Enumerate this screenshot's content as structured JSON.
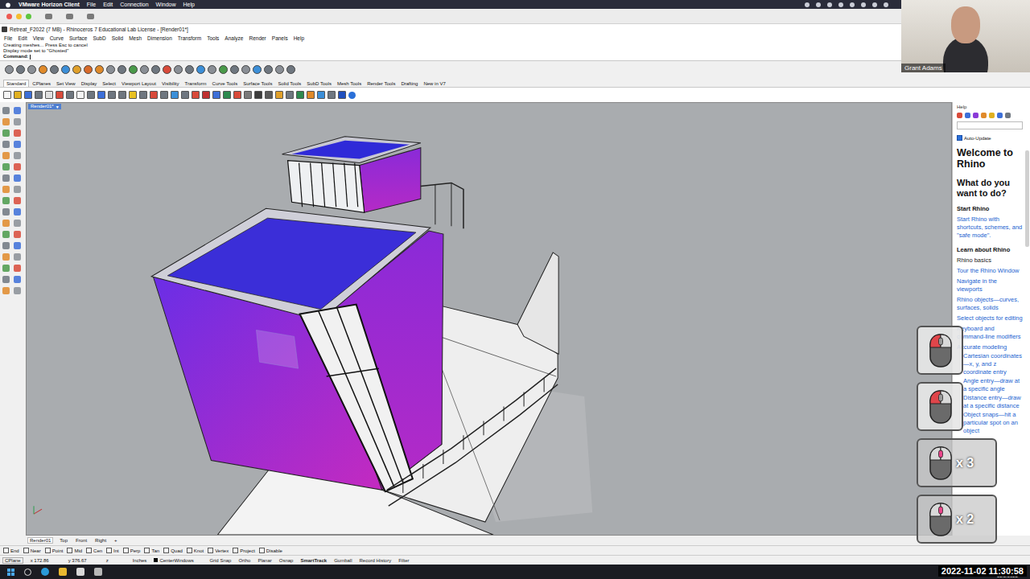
{
  "host_menu": {
    "app": "VMware Horizon Client",
    "items": [
      "File",
      "Edit",
      "Connection",
      "Window",
      "Help"
    ]
  },
  "window": {
    "title": "Retreat_F2022 (7 MB) - Rhinoceros 7 Educational Lab License - [Render01*]"
  },
  "menu": [
    "File",
    "Edit",
    "View",
    "Curve",
    "Surface",
    "SubD",
    "Solid",
    "Mesh",
    "Dimension",
    "Transform",
    "Tools",
    "Analyze",
    "Render",
    "Panels",
    "Help"
  ],
  "command_history": [
    "Creating meshes... Press Esc to cancel",
    "Display mode set to \"Ghosted\""
  ],
  "command_prompt": "Command:",
  "toolbar_tabs": [
    {
      "label": "Standard",
      "selected": true
    },
    {
      "label": "CPlanes",
      "selected": false
    },
    {
      "label": "Set View",
      "selected": false
    },
    {
      "label": "Display",
      "selected": false
    },
    {
      "label": "Select",
      "selected": false
    },
    {
      "label": "Viewport Layout",
      "selected": false
    },
    {
      "label": "Visibility",
      "selected": false
    },
    {
      "label": "Transform",
      "selected": false
    },
    {
      "label": "Curve Tools",
      "selected": false
    },
    {
      "label": "Surface Tools",
      "selected": false
    },
    {
      "label": "Solid Tools",
      "selected": false
    },
    {
      "label": "SubD Tools",
      "selected": false
    },
    {
      "label": "Mesh Tools",
      "selected": false
    },
    {
      "label": "Render Tools",
      "selected": false
    },
    {
      "label": "Drafting",
      "selected": false
    },
    {
      "label": "New in V7",
      "selected": false
    }
  ],
  "viewport": {
    "label": "Render01*",
    "menu_arrow": "▾"
  },
  "viewport_tabs": [
    {
      "label": "Render01",
      "selected": true
    },
    {
      "label": "Top",
      "selected": false
    },
    {
      "label": "Front",
      "selected": false
    },
    {
      "label": "Right",
      "selected": false
    },
    {
      "label": "+",
      "selected": false
    }
  ],
  "osnaps": [
    {
      "label": "End",
      "checked": false
    },
    {
      "label": "Near",
      "checked": false
    },
    {
      "label": "Point",
      "checked": false
    },
    {
      "label": "Mid",
      "checked": false
    },
    {
      "label": "Cen",
      "checked": false
    },
    {
      "label": "Int",
      "checked": false
    },
    {
      "label": "Perp",
      "checked": false
    },
    {
      "label": "Tan",
      "checked": false
    },
    {
      "label": "Quad",
      "checked": false
    },
    {
      "label": "Knot",
      "checked": false
    },
    {
      "label": "Vertex",
      "checked": false
    },
    {
      "label": "Project",
      "checked": false
    },
    {
      "label": "Disable",
      "checked": false
    }
  ],
  "status_bar": {
    "cplane": "CPlane",
    "x": "x 172.86",
    "y": "y 376.67",
    "z": "z",
    "units": "Inches",
    "layer": "CenterWindows",
    "toggles": [
      {
        "label": "Grid Snap",
        "on": false
      },
      {
        "label": "Ortho",
        "on": false
      },
      {
        "label": "Planar",
        "on": false
      },
      {
        "label": "Osnap",
        "on": false
      },
      {
        "label": "SmartTrack",
        "on": true
      },
      {
        "label": "Gumball",
        "on": false
      },
      {
        "label": "Record History",
        "on": false
      },
      {
        "label": "Filter",
        "on": false
      }
    ]
  },
  "help_panel": {
    "title": "Help",
    "auto_update": {
      "label": "Auto-Update",
      "checked": true
    },
    "heading": "Welcome to Rhino",
    "question": "What do you want to do?",
    "sections": [
      {
        "heading": "Start Rhino",
        "items": [
          {
            "text": "Start Rhino with shortcuts, schemes, and \"safe mode\".",
            "kind": "link"
          }
        ]
      },
      {
        "heading": "Learn about Rhino",
        "items": [
          {
            "text": "Rhino basics",
            "kind": "subheading"
          },
          {
            "text": "Tour the Rhino Window",
            "kind": "link"
          },
          {
            "text": "Navigate in the viewports",
            "kind": "link"
          },
          {
            "text": "Rhino objects—curves, surfaces, solids",
            "kind": "link"
          },
          {
            "text": "Select objects for editing",
            "kind": "link"
          },
          {
            "text": "Keyboard and command-line modifiers",
            "kind": "link"
          },
          {
            "text": "Accurate modeling",
            "kind": "link"
          },
          {
            "text": "Cartesian coordinates—x, y, and z coordinate entry",
            "kind": "indented"
          },
          {
            "text": "Angle entry—draw at a specific angle",
            "kind": "indented"
          },
          {
            "text": "Distance entry—draw at a specific distance",
            "kind": "indented"
          },
          {
            "text": "Object snaps—hit a particular spot on an object",
            "kind": "indented"
          }
        ]
      }
    ]
  },
  "video": {
    "name": "Grant Adams"
  },
  "click_indicators": [
    {
      "button": "left",
      "count": null
    },
    {
      "button": "left",
      "count": null
    },
    {
      "button": "middle",
      "count": "x 3"
    },
    {
      "button": "middle",
      "count": "x 2"
    }
  ],
  "taskbar": {
    "clock": "2022-11-02 11:30:58",
    "date": "11/2/2022"
  }
}
